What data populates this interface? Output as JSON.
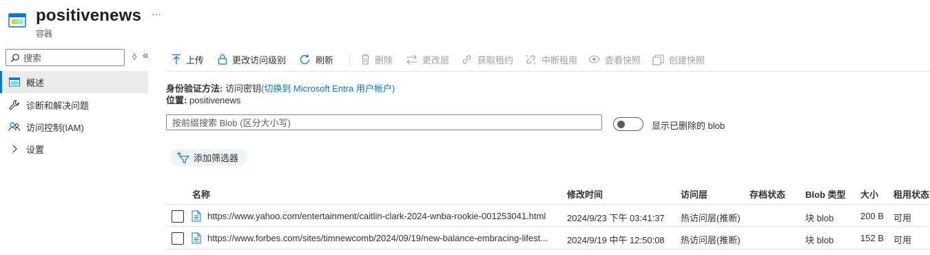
{
  "header": {
    "title": "positivenews",
    "more": "···",
    "subtitle": "容器"
  },
  "sidebar": {
    "search_placeholder": "搜索",
    "sort_glyph": "◊",
    "collapse_glyph": "«",
    "items": [
      {
        "label": "概述",
        "icon": "container-icon",
        "active": true
      },
      {
        "label": "诊断和解决问题",
        "icon": "wrench-icon"
      },
      {
        "label": "访问控制(IAM)",
        "icon": "people-icon"
      },
      {
        "label": "设置",
        "icon": "chevron-right-icon"
      }
    ]
  },
  "toolbar": {
    "upload": "上传",
    "change_access": "更改访问级别",
    "refresh": "刷新",
    "delete": "删除",
    "change_tier": "更改层",
    "acquire_lease": "获取租约",
    "break_lease": "中断租用",
    "view_snapshots": "查看快照",
    "create_snapshot": "创建快照"
  },
  "info": {
    "auth_label": "身份验证方法:",
    "auth_value": "访问密钥",
    "auth_link": "(切换到 Microsoft Entra 用户帐户)",
    "location_label": "位置:",
    "location_value": "positivenews"
  },
  "blob_search": {
    "placeholder": "按前缀搜索 Blob (区分大小写)"
  },
  "show_deleted": {
    "label": "显示已删除的 blob",
    "on": false
  },
  "add_filter": "添加筛选器",
  "table": {
    "columns": [
      "名称",
      "修改时间",
      "访问层",
      "存档状态",
      "Blob 类型",
      "大小",
      "租用状态"
    ],
    "rows": [
      {
        "name": "https://www.yahoo.com/entertainment/caitlin-clark-2024-wnba-rookie-001253041.html",
        "modified": "2024/9/23 下午 03:41:37",
        "tier": "热访问层(推断)",
        "archive": "",
        "type": "块 blob",
        "size": "200 B",
        "lease": "可用"
      },
      {
        "name": "https://www.forbes.com/sites/timnewcomb/2024/09/19/new-balance-embracing-lifest...",
        "modified": "2024/9/19 中午 12:50:08",
        "tier": "热访问层(推断)",
        "archive": "",
        "type": "块 blob",
        "size": "152 B",
        "lease": "可用"
      }
    ]
  },
  "colors": {
    "accent": "#0078d4",
    "active_bg": "#edebe9",
    "filter_bg": "#eff4f9"
  }
}
